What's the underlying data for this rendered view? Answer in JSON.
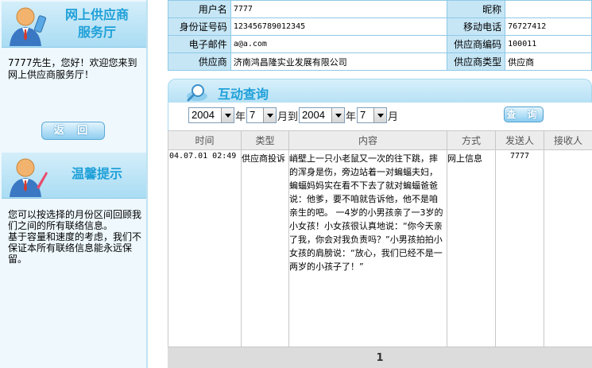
{
  "sidebar": {
    "service_title_line1": "网上供应商",
    "service_title_line2": "服务厅",
    "welcome": "7777先生，您好！欢迎您来到网上供应商服务厅！",
    "back_label": "返 回",
    "tips_title": "温馨提示",
    "tips_p1": "您可以按选择的月份区间回顾我们之间的所有联络信息。",
    "tips_p2": "基于容量和速度的考虑，我们不保证本所有联络信息能永远保留。"
  },
  "info": {
    "username_label": "用户名",
    "username": "7777",
    "nickname_label": "昵称",
    "nickname": "",
    "id_label": "身份证号码",
    "id": "123456789012345",
    "mobile_label": "移动电话",
    "mobile": "76727412",
    "email_label": "电子邮件",
    "email": "a@a.com",
    "supplier_code_label": "供应商编码",
    "supplier_code": "100011",
    "supplier_label": "供应商",
    "supplier": "济南鸿昌隆实业发展有限公司",
    "supplier_type_label": "供应商类型",
    "supplier_type": "供应商"
  },
  "query": {
    "title": "互动查询",
    "from_year": "2004",
    "from_month": "7",
    "to_year": "2004",
    "to_month": "7",
    "year_unit": "年",
    "month_unit_to": "月到",
    "month_unit": "月",
    "button": "查 询"
  },
  "grid": {
    "columns": [
      "时间",
      "类型",
      "内容",
      "方式",
      "发送人",
      "接收人"
    ],
    "rows": [
      {
        "time": "04.07.01 02:49",
        "type": "供应商投诉",
        "content": "峭壁上一只小老鼠又一次的往下跳，摔的浑身是伤，旁边站着一对蝙蝠夫妇，蝙蝠妈妈实在看不下去了就对蝙蝠爸爸说：他爹，要不咱就告诉他，他不是咱亲生的吧。 一4岁的小男孩亲了一3岁的小女孩！小女孩很认真地说：“你今天亲了我，你会对我负责吗？”小男孩拍拍小女孩的肩膀说：“放心，我们已经不是一两岁的小孩子了！”",
        "method": "网上信息",
        "sender": "7777",
        "receiver": ""
      }
    ]
  },
  "pager": {
    "page": "1"
  }
}
